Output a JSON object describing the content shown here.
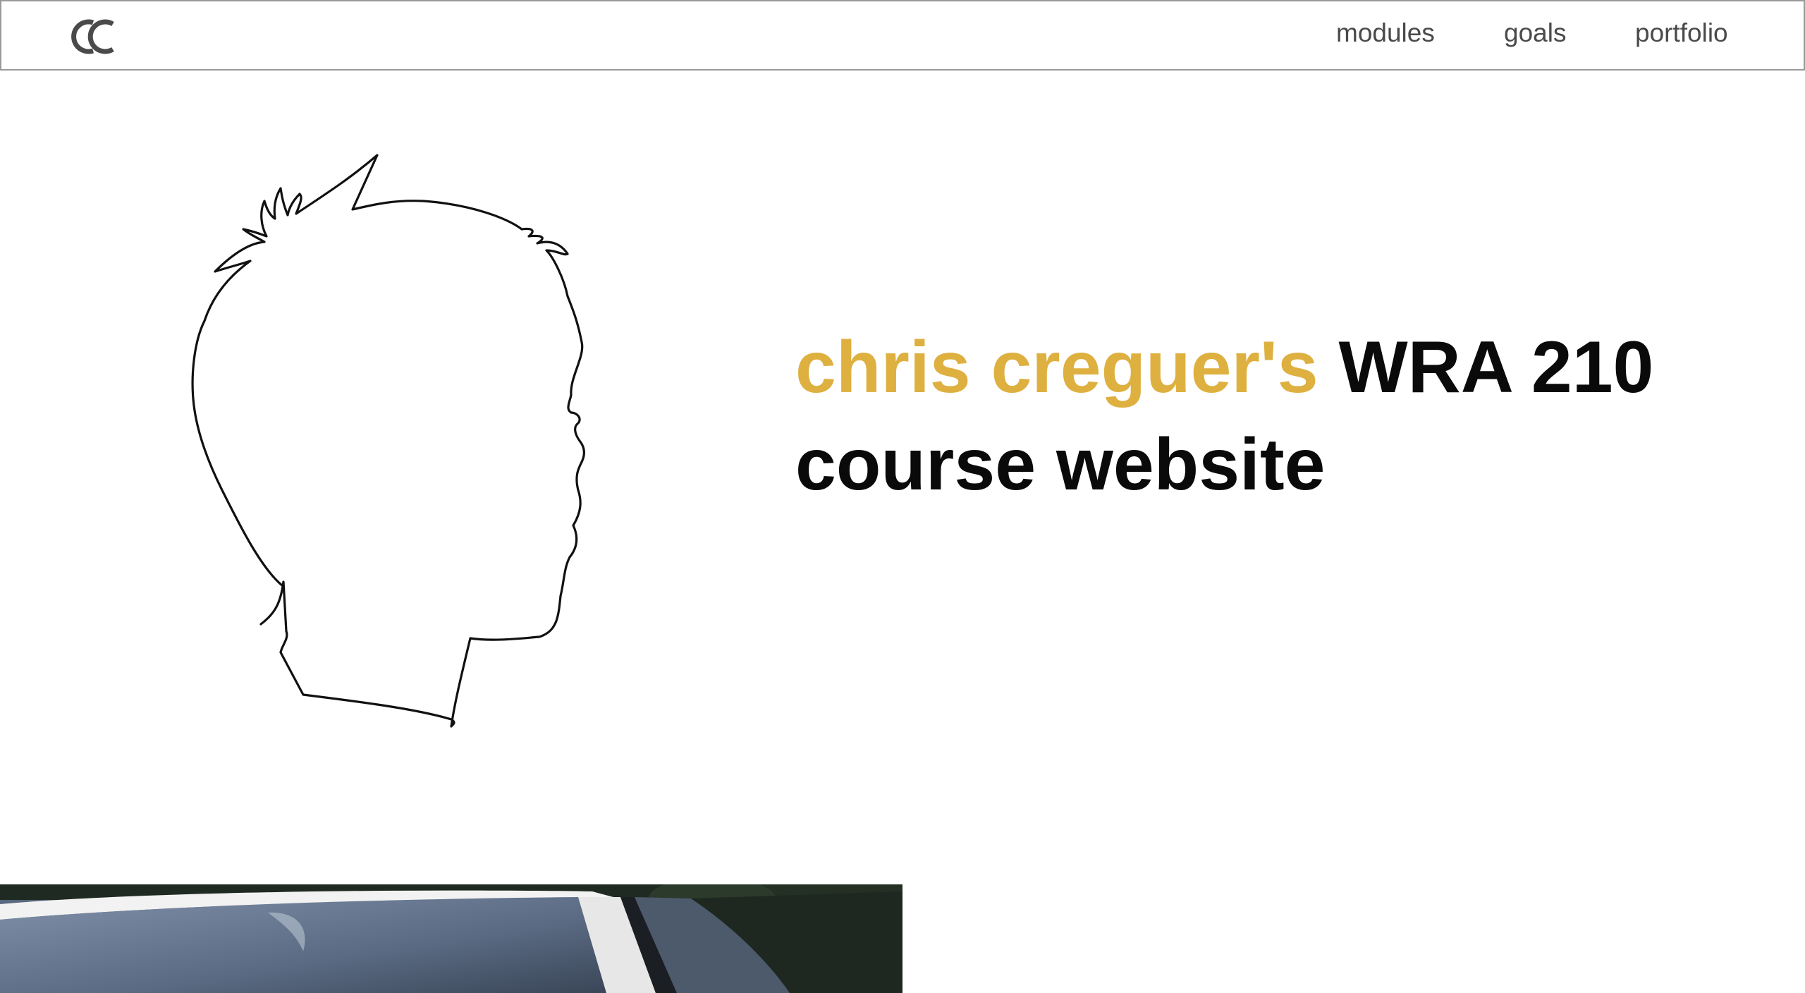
{
  "header": {
    "logo_text": "CC",
    "nav": [
      {
        "label": "modules"
      },
      {
        "label": "goals"
      },
      {
        "label": "portfolio"
      }
    ]
  },
  "hero": {
    "title_accent": "chris creguer's",
    "title_rest_line1": "WRA 210",
    "title_line2": "course website",
    "accent_color": "#deb040"
  },
  "icons": {
    "logo": "cc-monogram-logo",
    "silhouette": "head-silhouette-illustration"
  }
}
